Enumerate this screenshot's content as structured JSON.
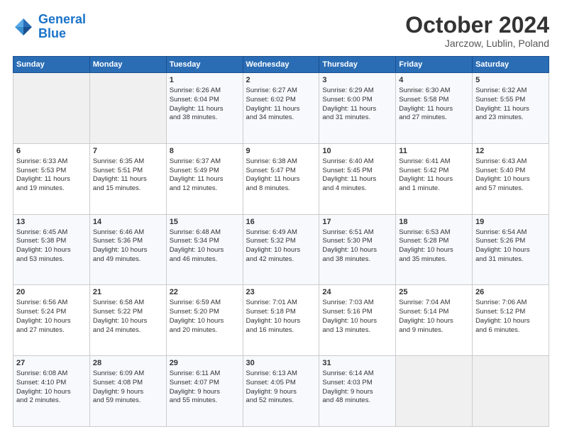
{
  "logo": {
    "line1": "General",
    "line2": "Blue"
  },
  "title": "October 2024",
  "subtitle": "Jarczow, Lublin, Poland",
  "days_of_week": [
    "Sunday",
    "Monday",
    "Tuesday",
    "Wednesday",
    "Thursday",
    "Friday",
    "Saturday"
  ],
  "weeks": [
    [
      {
        "day": "",
        "info": ""
      },
      {
        "day": "",
        "info": ""
      },
      {
        "day": "1",
        "info": "Sunrise: 6:26 AM\nSunset: 6:04 PM\nDaylight: 11 hours\nand 38 minutes."
      },
      {
        "day": "2",
        "info": "Sunrise: 6:27 AM\nSunset: 6:02 PM\nDaylight: 11 hours\nand 34 minutes."
      },
      {
        "day": "3",
        "info": "Sunrise: 6:29 AM\nSunset: 6:00 PM\nDaylight: 11 hours\nand 31 minutes."
      },
      {
        "day": "4",
        "info": "Sunrise: 6:30 AM\nSunset: 5:58 PM\nDaylight: 11 hours\nand 27 minutes."
      },
      {
        "day": "5",
        "info": "Sunrise: 6:32 AM\nSunset: 5:55 PM\nDaylight: 11 hours\nand 23 minutes."
      }
    ],
    [
      {
        "day": "6",
        "info": "Sunrise: 6:33 AM\nSunset: 5:53 PM\nDaylight: 11 hours\nand 19 minutes."
      },
      {
        "day": "7",
        "info": "Sunrise: 6:35 AM\nSunset: 5:51 PM\nDaylight: 11 hours\nand 15 minutes."
      },
      {
        "day": "8",
        "info": "Sunrise: 6:37 AM\nSunset: 5:49 PM\nDaylight: 11 hours\nand 12 minutes."
      },
      {
        "day": "9",
        "info": "Sunrise: 6:38 AM\nSunset: 5:47 PM\nDaylight: 11 hours\nand 8 minutes."
      },
      {
        "day": "10",
        "info": "Sunrise: 6:40 AM\nSunset: 5:45 PM\nDaylight: 11 hours\nand 4 minutes."
      },
      {
        "day": "11",
        "info": "Sunrise: 6:41 AM\nSunset: 5:42 PM\nDaylight: 11 hours\nand 1 minute."
      },
      {
        "day": "12",
        "info": "Sunrise: 6:43 AM\nSunset: 5:40 PM\nDaylight: 10 hours\nand 57 minutes."
      }
    ],
    [
      {
        "day": "13",
        "info": "Sunrise: 6:45 AM\nSunset: 5:38 PM\nDaylight: 10 hours\nand 53 minutes."
      },
      {
        "day": "14",
        "info": "Sunrise: 6:46 AM\nSunset: 5:36 PM\nDaylight: 10 hours\nand 49 minutes."
      },
      {
        "day": "15",
        "info": "Sunrise: 6:48 AM\nSunset: 5:34 PM\nDaylight: 10 hours\nand 46 minutes."
      },
      {
        "day": "16",
        "info": "Sunrise: 6:49 AM\nSunset: 5:32 PM\nDaylight: 10 hours\nand 42 minutes."
      },
      {
        "day": "17",
        "info": "Sunrise: 6:51 AM\nSunset: 5:30 PM\nDaylight: 10 hours\nand 38 minutes."
      },
      {
        "day": "18",
        "info": "Sunrise: 6:53 AM\nSunset: 5:28 PM\nDaylight: 10 hours\nand 35 minutes."
      },
      {
        "day": "19",
        "info": "Sunrise: 6:54 AM\nSunset: 5:26 PM\nDaylight: 10 hours\nand 31 minutes."
      }
    ],
    [
      {
        "day": "20",
        "info": "Sunrise: 6:56 AM\nSunset: 5:24 PM\nDaylight: 10 hours\nand 27 minutes."
      },
      {
        "day": "21",
        "info": "Sunrise: 6:58 AM\nSunset: 5:22 PM\nDaylight: 10 hours\nand 24 minutes."
      },
      {
        "day": "22",
        "info": "Sunrise: 6:59 AM\nSunset: 5:20 PM\nDaylight: 10 hours\nand 20 minutes."
      },
      {
        "day": "23",
        "info": "Sunrise: 7:01 AM\nSunset: 5:18 PM\nDaylight: 10 hours\nand 16 minutes."
      },
      {
        "day": "24",
        "info": "Sunrise: 7:03 AM\nSunset: 5:16 PM\nDaylight: 10 hours\nand 13 minutes."
      },
      {
        "day": "25",
        "info": "Sunrise: 7:04 AM\nSunset: 5:14 PM\nDaylight: 10 hours\nand 9 minutes."
      },
      {
        "day": "26",
        "info": "Sunrise: 7:06 AM\nSunset: 5:12 PM\nDaylight: 10 hours\nand 6 minutes."
      }
    ],
    [
      {
        "day": "27",
        "info": "Sunrise: 6:08 AM\nSunset: 4:10 PM\nDaylight: 10 hours\nand 2 minutes."
      },
      {
        "day": "28",
        "info": "Sunrise: 6:09 AM\nSunset: 4:08 PM\nDaylight: 9 hours\nand 59 minutes."
      },
      {
        "day": "29",
        "info": "Sunrise: 6:11 AM\nSunset: 4:07 PM\nDaylight: 9 hours\nand 55 minutes."
      },
      {
        "day": "30",
        "info": "Sunrise: 6:13 AM\nSunset: 4:05 PM\nDaylight: 9 hours\nand 52 minutes."
      },
      {
        "day": "31",
        "info": "Sunrise: 6:14 AM\nSunset: 4:03 PM\nDaylight: 9 hours\nand 48 minutes."
      },
      {
        "day": "",
        "info": ""
      },
      {
        "day": "",
        "info": ""
      }
    ]
  ]
}
